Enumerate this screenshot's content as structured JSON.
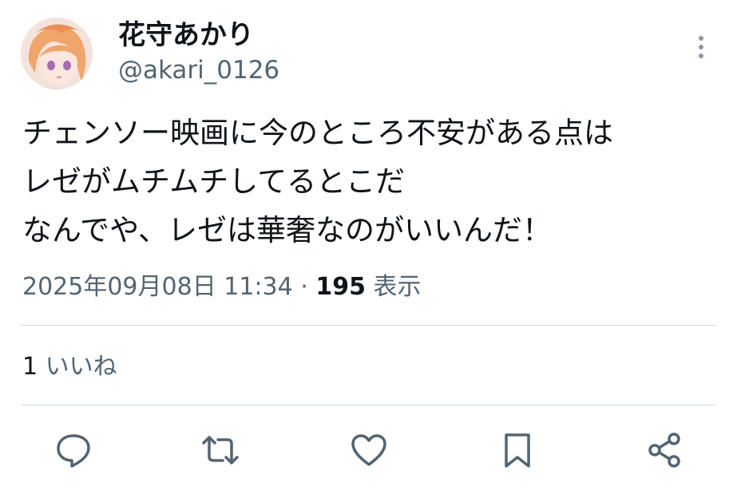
{
  "user": {
    "display_name": "花守あかり",
    "handle": "@akari_0126"
  },
  "tweet": {
    "lines": [
      "チェンソー映画に今のところ不安がある点は",
      "レゼがムチムチしてるとこだ",
      "なんでや、レゼは華奢なのがいいんだ！"
    ],
    "timestamp": "2025年09月08日 11:34",
    "separator": "·",
    "views_count": "195",
    "views_label": "表示"
  },
  "stats": {
    "likes_count": "1",
    "likes_label": "いいね"
  },
  "actions": [
    "reply-icon",
    "retweet-icon",
    "like-icon",
    "bookmark-icon",
    "share-icon"
  ],
  "colors": {
    "text": "#0f1419",
    "secondary": "#536471",
    "divider": "#cfd9de",
    "icon": "#536471"
  }
}
